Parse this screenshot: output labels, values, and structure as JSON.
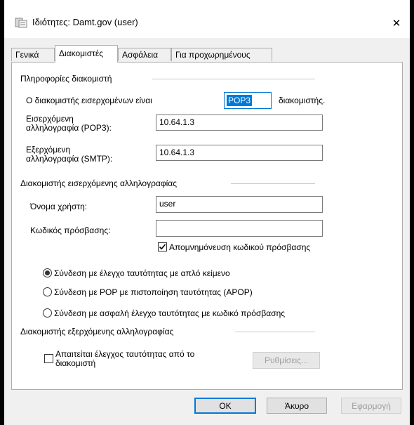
{
  "window": {
    "title": "Ιδιότητες: Damt.gov (user)",
    "close_glyph": "✕"
  },
  "tabs": [
    {
      "label": "Γενικά",
      "active": false
    },
    {
      "label": "Διακομιστές",
      "active": true
    },
    {
      "label": "Ασφάλεια",
      "active": false
    },
    {
      "label": "Για προχωρημένους",
      "active": false
    }
  ],
  "server_info": {
    "heading": "Πληροφορίες διακομιστή",
    "incoming_type_label": "Ο διακομιστής εισερχομένων είναι",
    "incoming_type_value": "POP3",
    "incoming_type_suffix": "διακομιστής.",
    "incoming_label_line1": "Εισερχόμενη",
    "incoming_label_line2": "αλληλογραφία (POP3):",
    "incoming_value": "10.64.1.3",
    "outgoing_label_line1": "Εξερχόμενη",
    "outgoing_label_line2": "αλληλογραφία (SMTP):",
    "outgoing_value": "10.64.1.3"
  },
  "incoming_server": {
    "heading": "Διακομιστής εισερχόμενης αλληλογραφίας",
    "username_label": "Όνομα χρήστη:",
    "username_value": "user",
    "password_label": "Κωδικός πρόσβασης:",
    "password_value": "",
    "remember_password_label": "Απομνημόνευση κωδικού πρόσβασης",
    "remember_password_checked": true,
    "auth_options": [
      {
        "label": "Σύνδεση με έλεγχο ταυτότητας με απλό κείμενο",
        "selected": true
      },
      {
        "label": "Σύνδεση με POP με πιστοποίηση ταυτότητας (APOP)",
        "selected": false
      },
      {
        "label": "Σύνδεση με ασφαλή έλεγχο ταυτότητας με κωδικό πρόσβασης",
        "selected": false
      }
    ]
  },
  "outgoing_server": {
    "heading": "Διακομιστής εξερχόμενης αλληλογραφίας",
    "requires_auth_line1": "Απαιτείται έλεγχος ταυτότητας από το",
    "requires_auth_line2": "διακομιστή",
    "requires_auth_checked": false,
    "settings_button": "Ρυθμίσεις..."
  },
  "buttons": {
    "ok": "OK",
    "cancel": "Άκυρο",
    "apply": "Εφαρμογή"
  }
}
